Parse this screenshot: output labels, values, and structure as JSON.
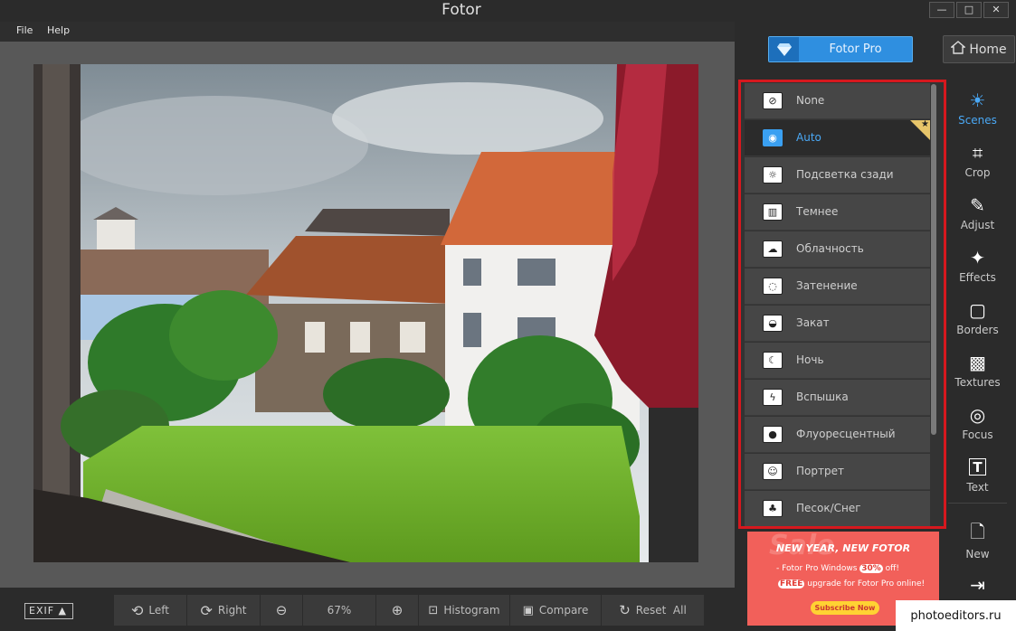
{
  "window": {
    "title": "Fotor",
    "minimize": "—",
    "maximize": "□",
    "close": "✕"
  },
  "menu": {
    "items": [
      "File",
      "Help"
    ]
  },
  "toolbar": {
    "exif": "EXIF ▲",
    "left": "Left",
    "right": "Right",
    "zoom": "67%",
    "histogram": "Histogram",
    "compare": "Compare",
    "reset": "Reset  All"
  },
  "header": {
    "pro_label": "Fotor Pro",
    "home_label": "Home"
  },
  "scenes": {
    "items": [
      {
        "label": "None",
        "icon": "no-icon"
      },
      {
        "label": "Auto",
        "icon": "camera-icon"
      },
      {
        "label": "Подсветка сзади",
        "icon": "backlight-icon"
      },
      {
        "label": "Темнее",
        "icon": "darker-icon"
      },
      {
        "label": "Облачность",
        "icon": "cloud-icon"
      },
      {
        "label": "Затенение",
        "icon": "shade-icon"
      },
      {
        "label": "Закат",
        "icon": "sunset-icon"
      },
      {
        "label": "Ночь",
        "icon": "night-icon"
      },
      {
        "label": "Вспышка",
        "icon": "flash-icon"
      },
      {
        "label": "Флуоресцентный",
        "icon": "fluorescent-icon"
      },
      {
        "label": "Портрет",
        "icon": "portrait-icon"
      },
      {
        "label": "Песок/Снег",
        "icon": "beach-icon"
      }
    ],
    "active_index": 1
  },
  "tools": {
    "items": [
      "Scenes",
      "Crop",
      "Adjust",
      "Effects",
      "Borders",
      "Textures",
      "Focus",
      "Text"
    ],
    "new_label": "New"
  },
  "ad": {
    "title": "NEW YEAR, NEW FOTOR",
    "line1_pre": "- Fotor Pro Windows ",
    "line1_hl": "30%",
    "line1_post": " off!",
    "line2_free": "FREE",
    "line2_post": " upgrade for Fotor Pro online!",
    "button": "Subscribe Now"
  },
  "credit": "photoeditors.ru",
  "colors": {
    "accent": "#2f8fe0",
    "highlight_border": "#d6181e",
    "badge": "#e7c56a"
  }
}
